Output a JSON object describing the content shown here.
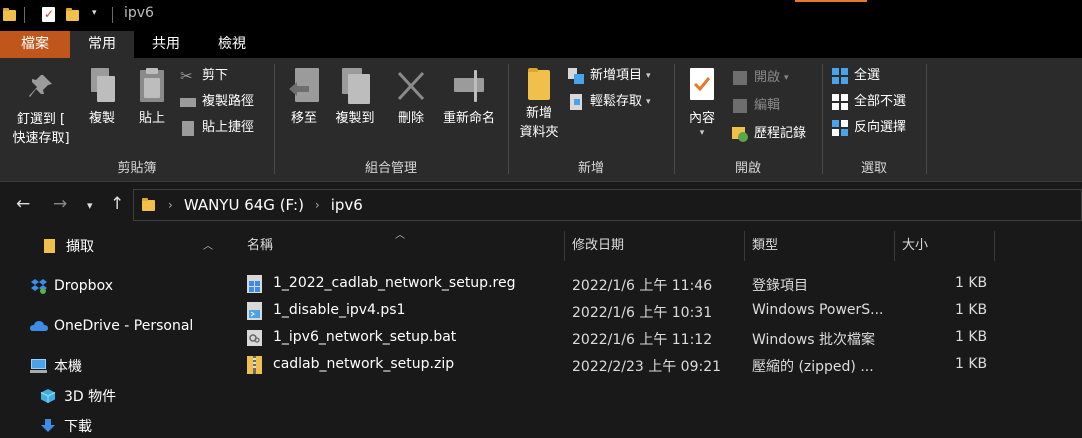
{
  "window": {
    "title": "ipv6"
  },
  "tabs": {
    "file": "檔案",
    "home": "常用",
    "share": "共用",
    "view": "檢視"
  },
  "ribbon": {
    "clipboard": {
      "label": "剪貼簿",
      "pin": "釘選到 [\n快速存取]",
      "pin_line1": "釘選到 [",
      "pin_line2": "快速存取]",
      "copy": "複製",
      "paste": "貼上",
      "cut": "剪下",
      "copy_path": "複製路徑",
      "paste_shortcut": "貼上捷徑"
    },
    "organize": {
      "label": "組合管理",
      "move_to": "移至",
      "copy_to": "複製到",
      "delete": "刪除",
      "rename": "重新命名"
    },
    "new": {
      "label": "新增",
      "new_folder_line1": "新增",
      "new_folder_line2": "資料夾",
      "new_item": "新增項目",
      "easy_access": "輕鬆存取"
    },
    "open": {
      "label": "開啟",
      "properties": "內容",
      "open": "開啟",
      "edit": "編輯",
      "history": "歷程記錄"
    },
    "select": {
      "label": "選取",
      "select_all": "全選",
      "select_none": "全部不選",
      "invert": "反向選擇"
    }
  },
  "address": {
    "segments": [
      "WANYU 64G (F:)",
      "ipv6"
    ]
  },
  "nav": {
    "items": [
      {
        "label": "擷取",
        "icon": "folder-icon"
      },
      {
        "label": "Dropbox",
        "icon": "dropbox-icon"
      },
      {
        "label": "OneDrive - Personal",
        "icon": "onedrive-icon"
      },
      {
        "label": "本機",
        "icon": "computer-icon"
      },
      {
        "label": "3D 物件",
        "icon": "3d-objects-icon"
      },
      {
        "label": "下載",
        "icon": "download-icon"
      }
    ]
  },
  "columns": {
    "name": "名稱",
    "date": "修改日期",
    "type": "類型",
    "size": "大小"
  },
  "files": [
    {
      "name": "1_2022_cadlab_network_setup.reg",
      "date": "2022/1/6 上午 11:46",
      "type": "登錄項目",
      "size": "1 KB",
      "icon": "reg-file-icon"
    },
    {
      "name": "1_disable_ipv4.ps1",
      "date": "2022/1/6 上午 10:31",
      "type": "Windows PowerS...",
      "size": "1 KB",
      "icon": "ps1-file-icon"
    },
    {
      "name": "1_ipv6_network_setup.bat",
      "date": "2022/1/6 上午 11:12",
      "type": "Windows 批次檔案",
      "size": "1 KB",
      "icon": "bat-file-icon"
    },
    {
      "name": "cadlab_network_setup.zip",
      "date": "2022/2/23 上午 09:21",
      "type": "壓縮的 (zipped) ...",
      "size": "1 KB",
      "icon": "zip-file-icon"
    }
  ],
  "colors": {
    "file_tab": "#c1561c",
    "folder": "#f0c04a",
    "select_blue": "#4aa3e8"
  }
}
